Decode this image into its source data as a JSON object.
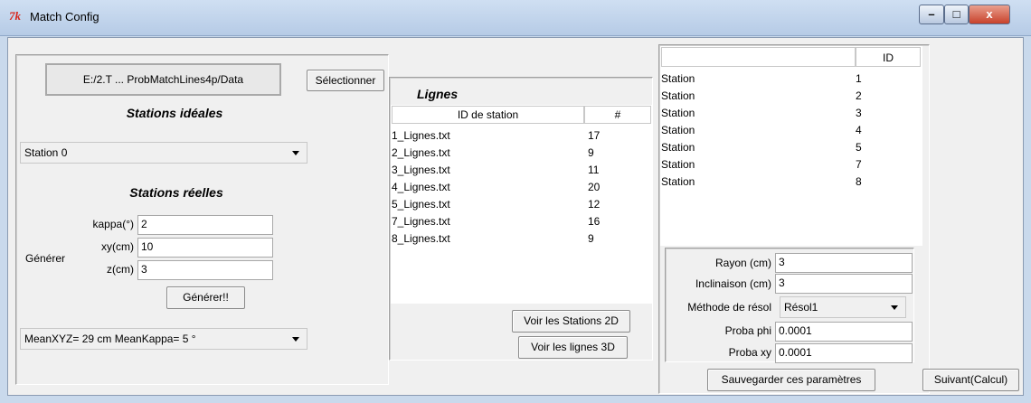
{
  "window": {
    "title": "Match Config",
    "minimize": "–",
    "maximize": "□",
    "close": "x"
  },
  "left": {
    "path": "E:/2.T ... ProbMatchLines4p/Data",
    "select_button": "Sélectionner",
    "ideal_title": "Stations idéales",
    "ideal_select": "Station 0",
    "real_title": "Stations réelles",
    "kappa_label": "kappa(°)",
    "kappa_value": "2",
    "xy_label": "xy(cm)",
    "xy_value": "10",
    "z_label": "z(cm)",
    "z_value": "3",
    "generate_label": "Générer",
    "generate_button": "Générer!!",
    "result_select": "MeanXYZ= 29 cm  MeanKappa= 5 °"
  },
  "middle": {
    "title": "Lignes",
    "col_id": "ID de station",
    "col_count": "#",
    "rows": [
      {
        "file": "1_Lignes.txt",
        "count": "17"
      },
      {
        "file": "2_Lignes.txt",
        "count": "9"
      },
      {
        "file": "3_Lignes.txt",
        "count": "11"
      },
      {
        "file": "4_Lignes.txt",
        "count": "20"
      },
      {
        "file": "5_Lignes.txt",
        "count": "12"
      },
      {
        "file": "7_Lignes.txt",
        "count": "16"
      },
      {
        "file": "8_Lignes.txt",
        "count": "9"
      }
    ],
    "btn_2d": "Voir les Stations 2D",
    "btn_3d": "Voir les lignes 3D"
  },
  "right": {
    "col_id": "ID",
    "rows": [
      {
        "name": "Station",
        "id": "1"
      },
      {
        "name": "Station",
        "id": "2"
      },
      {
        "name": "Station",
        "id": "3"
      },
      {
        "name": "Station",
        "id": "4"
      },
      {
        "name": "Station",
        "id": "5"
      },
      {
        "name": "Station",
        "id": "7"
      },
      {
        "name": "Station",
        "id": "8"
      }
    ],
    "rayon_label": "Rayon (cm)",
    "rayon_value": "3",
    "incl_label": "Inclinaison (cm)",
    "incl_value": "3",
    "methode_label": "Méthode de résol",
    "methode_value": "Résol1",
    "phi_label": "Proba phi",
    "phi_value": "0.0001",
    "xy_label": "Proba xy",
    "xy_value": "0.0001",
    "save_button": "Sauvegarder ces paramètres",
    "next_button": "Suivant(Calcul)"
  }
}
